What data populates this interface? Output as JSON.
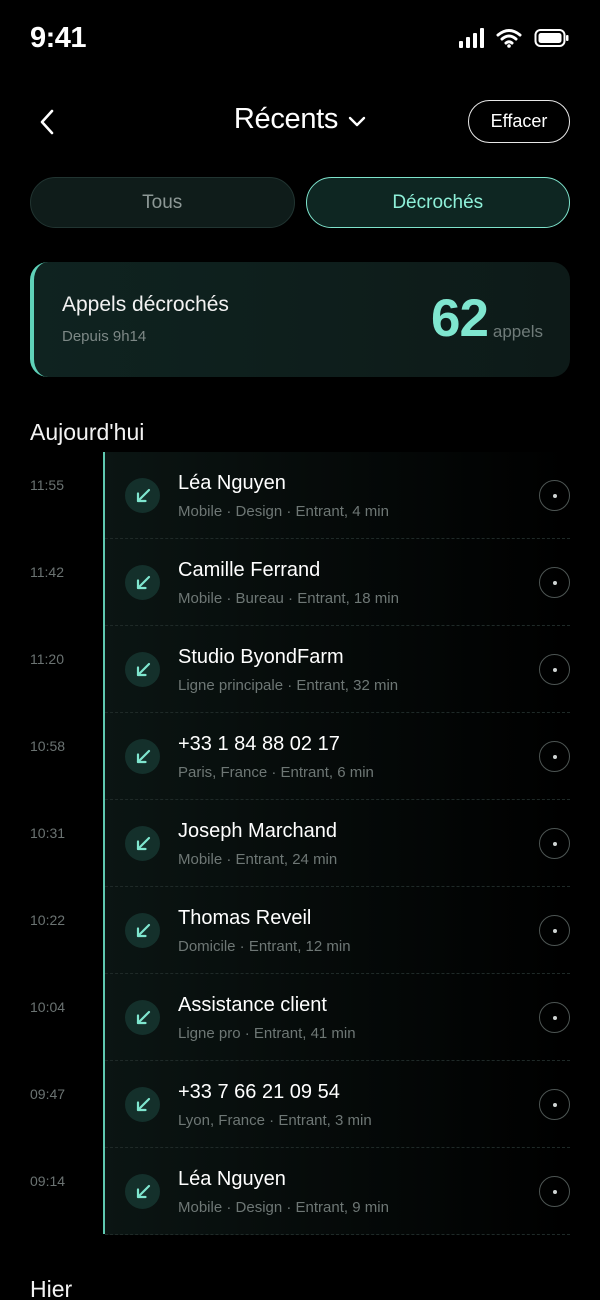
{
  "status_bar": {
    "time": "9:41",
    "icons": [
      "signal-icon",
      "wifi-icon",
      "battery-icon"
    ]
  },
  "nav": {
    "back_icon": "chevron-left-icon",
    "title": "Récents",
    "title_icon": "chevron-down-icon",
    "clear_label": "Effacer"
  },
  "segments": [
    {
      "label": "Tous",
      "active": false
    },
    {
      "label": "Décrochés",
      "active": true
    }
  ],
  "summary": {
    "title": "Appels décrochés",
    "subtitle": "Depuis 9h14",
    "count": "62",
    "unit": "appels"
  },
  "sections": {
    "today": "Aujourd'hui",
    "yesterday": "Hier"
  },
  "colors": {
    "accent": "#7fe6cf",
    "accent_line": "#5fc9b1",
    "background": "#000000"
  },
  "calls": [
    {
      "time": "11:55",
      "name": "Léa Nguyen",
      "detail": "Mobile · Design · Entrant, 4 min",
      "icon": "incoming-call-arrow-icon"
    },
    {
      "time": "11:42",
      "name": "Camille Ferrand",
      "detail": "Mobile · Bureau · Entrant, 18 min",
      "icon": "incoming-call-arrow-icon"
    },
    {
      "time": "11:20",
      "name": "Studio ByondFarm",
      "detail": "Ligne principale · Entrant, 32 min",
      "icon": "incoming-call-arrow-icon"
    },
    {
      "time": "10:58",
      "name": "+33 1 84 88 02 17",
      "detail": "Paris, France · Entrant, 6 min",
      "icon": "incoming-call-arrow-icon"
    },
    {
      "time": "10:31",
      "name": "Joseph Marchand",
      "detail": "Mobile · Entrant, 24 min",
      "icon": "incoming-call-arrow-icon"
    },
    {
      "time": "10:22",
      "name": "Thomas Reveil",
      "detail": "Domicile · Entrant, 12 min",
      "icon": "incoming-call-arrow-icon"
    },
    {
      "time": "10:04",
      "name": "Assistance client",
      "detail": "Ligne pro · Entrant, 41 min",
      "icon": "incoming-call-arrow-icon"
    },
    {
      "time": "09:47",
      "name": "+33 7 66 21 09 54",
      "detail": "Lyon, France · Entrant, 3 min",
      "icon": "incoming-call-arrow-icon"
    },
    {
      "time": "09:14",
      "name": "Léa Nguyen",
      "detail": "Mobile · Design · Entrant, 9 min",
      "icon": "incoming-call-arrow-icon"
    }
  ]
}
